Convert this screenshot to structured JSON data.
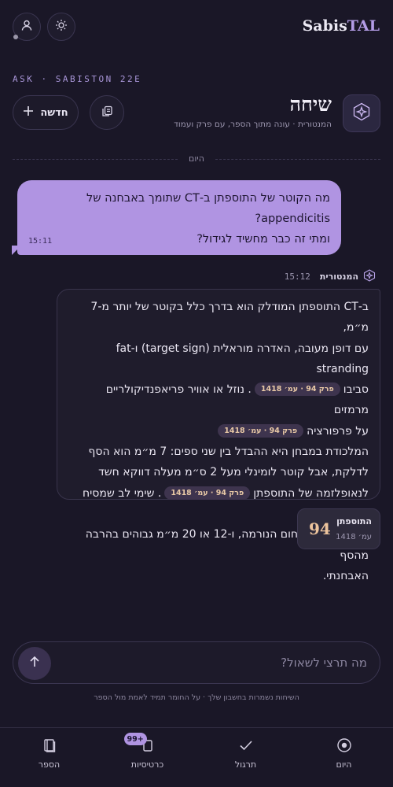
{
  "brand": {
    "name_main": "Sabis",
    "name_accent": "TAL"
  },
  "eyebrow": "ASK · SABISTON 22E",
  "header": {
    "title": "שיחה",
    "subtitle": "המנטורית · עונה מתוך הספר, עם פרק ועמוד",
    "new_label": "חדשה"
  },
  "conversation": {
    "divider_label": "היום",
    "user_message": {
      "line1": "מה הקוטר של התוספתן ב-CT שתומך באבחנה של appendicitis?",
      "line2": "ומתי זה כבר מחשיד לגידול?",
      "time": "15:11"
    },
    "assistant": {
      "name": "המנטורית",
      "time": "15:12",
      "para1_a": "ב-CT התוספתן המודלק הוא בדרך כלל בקוטר של יותר מ-7 מ״מ,",
      "para1_b": "עם דופן מעובה, האדרה מוראלית (target sign) ו-fat stranding",
      "para1_c": "סביבו",
      "cite1": "פרק 94 · עמ׳ 1418",
      "para1_d": ". נוזל או אוויר פריאפנדיקולריים מרמזים",
      "para1_e": "על פרפורציה",
      "cite2": "פרק 94 · עמ׳ 1418",
      "para2_a": "המלכודת במבחן היא ההבדל בין שני ספים: 7 מ״מ הוא הסף",
      "para2_b": "לדלקת, אבל קוטר לומינלי מעל 2 ס״מ מעלה דווקא חשד",
      "para2_c": "לנאופלזמה של התוספתן",
      "cite3": "פרק 94 · עמ׳ 1418",
      "para2_d": ". שימי לב שמסיח כמו",
      "para2_e": "4 מ״מ הוא בתחום הנורמה, ו-12 או 20 מ״מ גבוהים בהרבה מהסף",
      "para2_f": "האבחנתי."
    },
    "source_card": {
      "chapter": "94",
      "title": "התוספתן",
      "page": "עמ׳ 1418"
    }
  },
  "composer": {
    "placeholder": "מה תרצי לשאול?"
  },
  "footnote": "השיחות נשמרות בחשבון שלך · על החומר תמיד לאמת מול הספר",
  "bottom_nav": {
    "items": [
      {
        "label": "הספר"
      },
      {
        "label": "כרטיסיות",
        "badge": "99+"
      },
      {
        "label": "תרגול"
      },
      {
        "label": "היום"
      }
    ]
  },
  "colors": {
    "background": "#1a1727",
    "accent": "#b094e2",
    "citation": "#e9c9a6"
  }
}
